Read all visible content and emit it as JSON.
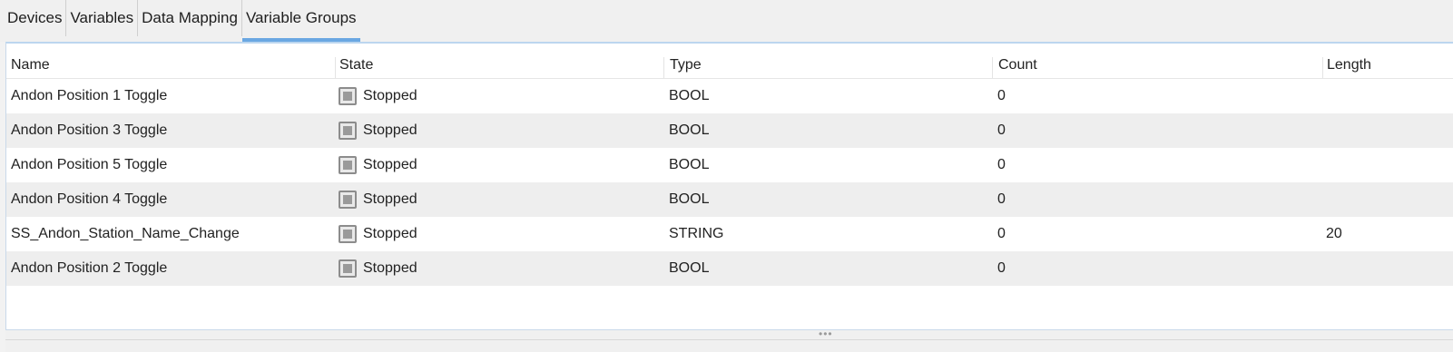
{
  "tabs": [
    {
      "label": "Devices"
    },
    {
      "label": "Variables"
    },
    {
      "label": "Data Mapping"
    },
    {
      "label": "Variable Groups"
    }
  ],
  "table": {
    "headers": {
      "name": "Name",
      "state": "State",
      "type": "Type",
      "count": "Count",
      "length": "Length"
    },
    "rows": [
      {
        "name": "Andon Position 1 Toggle",
        "state": "Stopped",
        "type": "BOOL",
        "count": "0",
        "length": ""
      },
      {
        "name": "Andon Position 3 Toggle",
        "state": "Stopped",
        "type": "BOOL",
        "count": "0",
        "length": ""
      },
      {
        "name": "Andon Position 5 Toggle",
        "state": "Stopped",
        "type": "BOOL",
        "count": "0",
        "length": ""
      },
      {
        "name": "Andon Position 4 Toggle",
        "state": "Stopped",
        "type": "BOOL",
        "count": "0",
        "length": ""
      },
      {
        "name": "SS_Andon_Station_Name_Change",
        "state": "Stopped",
        "type": "STRING",
        "count": "0",
        "length": "20"
      },
      {
        "name": "Andon Position 2 Toggle",
        "state": "Stopped",
        "type": "BOOL",
        "count": "0",
        "length": ""
      }
    ]
  },
  "splitter": {
    "grip": "•••"
  },
  "colors": {
    "active_tab_underline": "#6aa7e2",
    "alt_row": "#eeeeee"
  }
}
